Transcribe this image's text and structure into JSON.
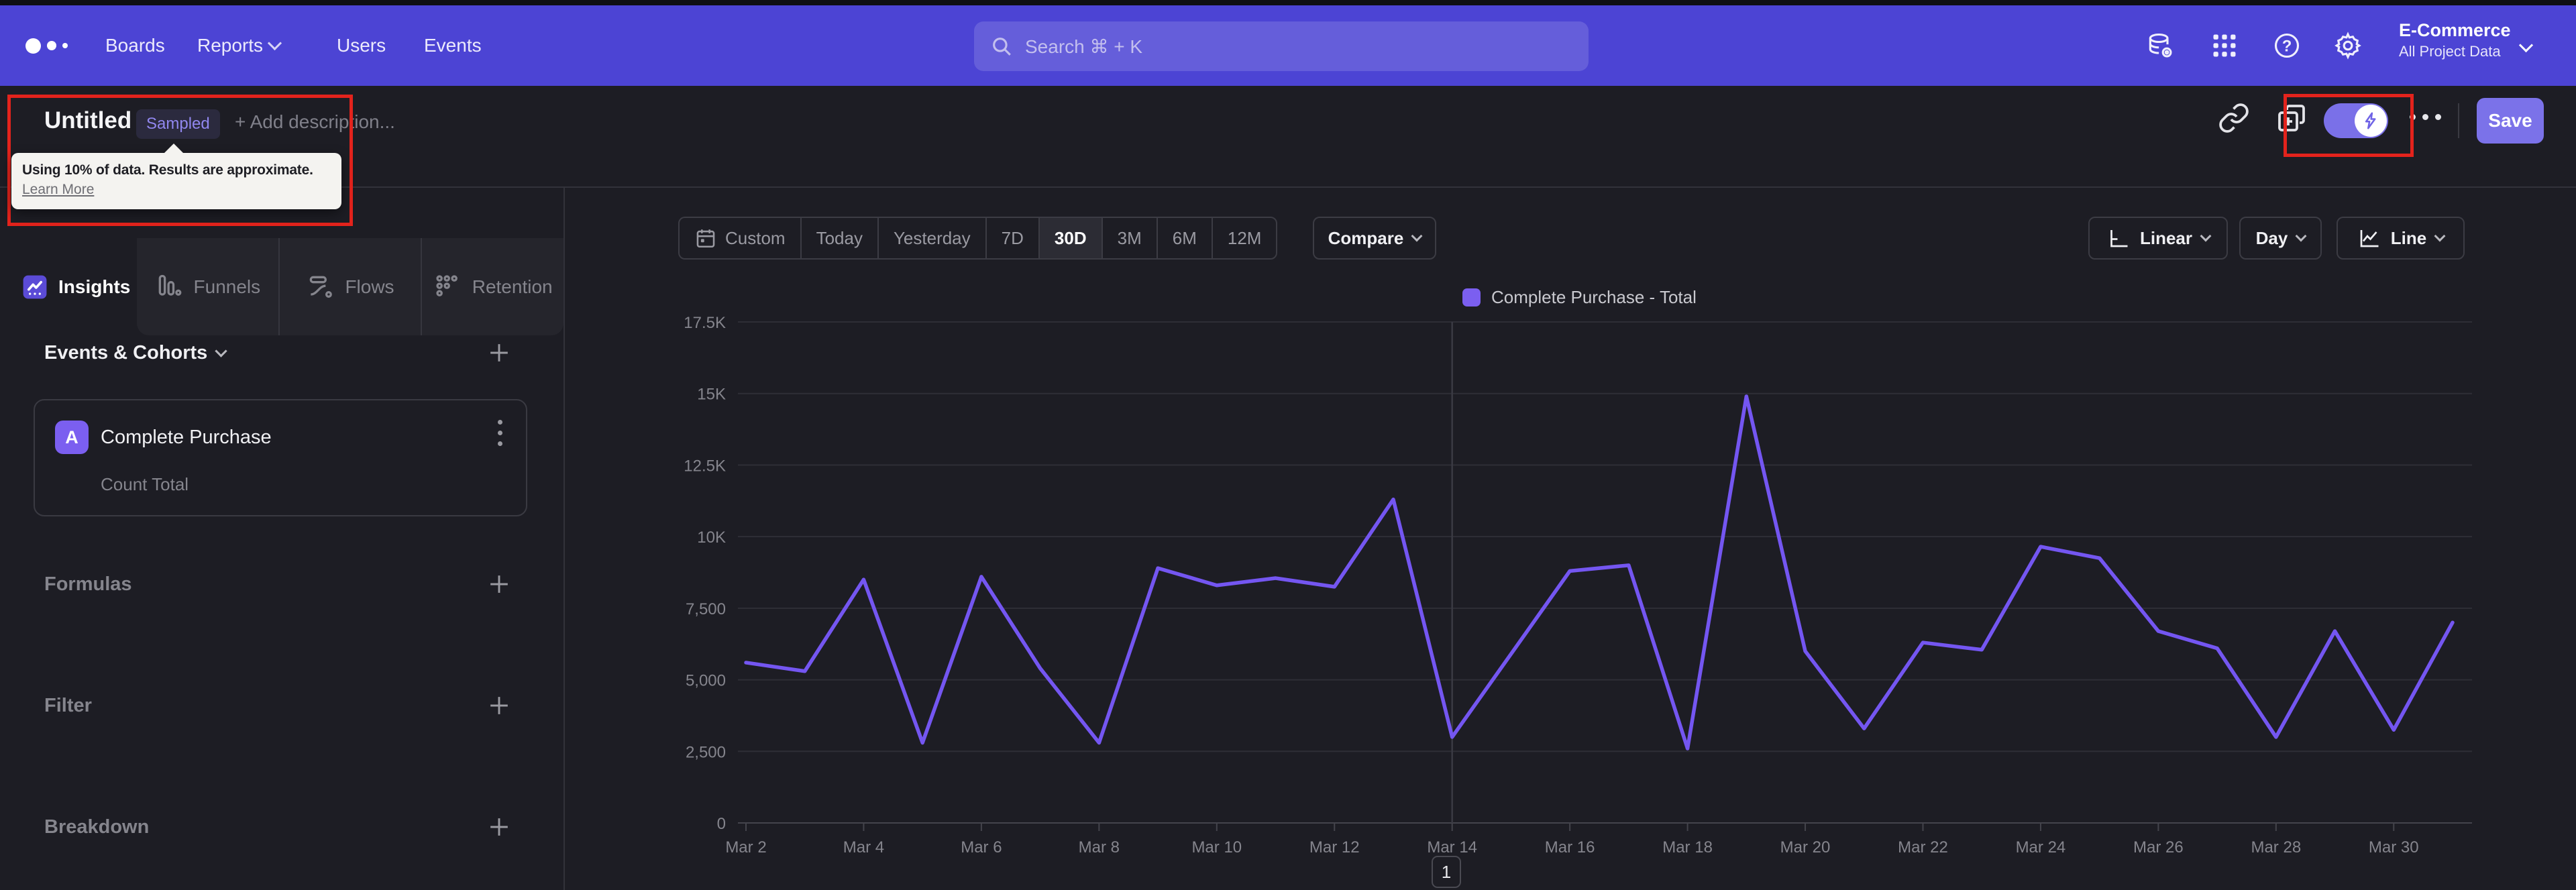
{
  "nav": {
    "items": [
      {
        "label": "Boards",
        "chevron": false
      },
      {
        "label": "Reports",
        "chevron": true
      },
      {
        "label": "Users",
        "chevron": false
      },
      {
        "label": "Events",
        "chevron": false
      }
    ],
    "search_placeholder": "Search  ⌘ + K",
    "project": {
      "name": "E-Commerce",
      "scope": "All Project Data"
    }
  },
  "report_header": {
    "title": "Untitled",
    "badge": "Sampled",
    "add_description": "+ Add description...",
    "tooltip": {
      "line1": "Using 10% of data. Results are approximate.",
      "link": "Learn More"
    },
    "save_label": "Save"
  },
  "sidebar": {
    "tabs": [
      {
        "label": "Insights",
        "active": true
      },
      {
        "label": "Funnels",
        "active": false
      },
      {
        "label": "Flows",
        "active": false
      },
      {
        "label": "Retention",
        "active": false
      }
    ],
    "events_title": "Events & Cohorts",
    "event_card": {
      "letter": "A",
      "name": "Complete Purchase",
      "metric": "Count Total"
    },
    "sections": [
      "Formulas",
      "Filter",
      "Breakdown"
    ]
  },
  "controls": {
    "date_ranges": [
      "Custom",
      "Today",
      "Yesterday",
      "7D",
      "30D",
      "3M",
      "6M",
      "12M"
    ],
    "active_range": "30D",
    "compare_label": "Compare",
    "linear_label": "Linear",
    "day_label": "Day",
    "line_label": "Line"
  },
  "chart_data": {
    "type": "line",
    "series": [
      {
        "name": "Complete Purchase - Total",
        "color": "#7456f1",
        "values": [
          5600,
          5300,
          8500,
          2800,
          8600,
          5400,
          2800,
          8900,
          8300,
          8550,
          8250,
          11300,
          3000,
          5900,
          8800,
          9000,
          2600,
          14900,
          6000,
          3300,
          6300,
          6050,
          9650,
          9250,
          6700,
          6100,
          3000,
          6700,
          3250,
          7000
        ]
      }
    ],
    "x": [
      "Mar 2",
      "Mar 3",
      "Mar 4",
      "Mar 5",
      "Mar 6",
      "Mar 7",
      "Mar 8",
      "Mar 9",
      "Mar 10",
      "Mar 11",
      "Mar 12",
      "Mar 13",
      "Mar 14",
      "Mar 15",
      "Mar 16",
      "Mar 17",
      "Mar 18",
      "Mar 19",
      "Mar 20",
      "Mar 21",
      "Mar 22",
      "Mar 23",
      "Mar 24",
      "Mar 25",
      "Mar 26",
      "Mar 27",
      "Mar 28",
      "Mar 29",
      "Mar 30",
      "Mar 31"
    ],
    "x_label_every": 2,
    "ylim": [
      0,
      17500
    ],
    "y_ticks": [
      {
        "value": 17500,
        "label": "17.5K"
      },
      {
        "value": 15000,
        "label": "15K"
      },
      {
        "value": 12500,
        "label": "12.5K"
      },
      {
        "value": 10000,
        "label": "10K"
      },
      {
        "value": 7500,
        "label": "7,500"
      },
      {
        "value": 5000,
        "label": "5,000"
      },
      {
        "value": 2500,
        "label": "2,500"
      },
      {
        "value": 0,
        "label": "0"
      }
    ],
    "highlight_x_index": 12,
    "legend_position": "top-center",
    "grid": true,
    "pagination": "1"
  }
}
